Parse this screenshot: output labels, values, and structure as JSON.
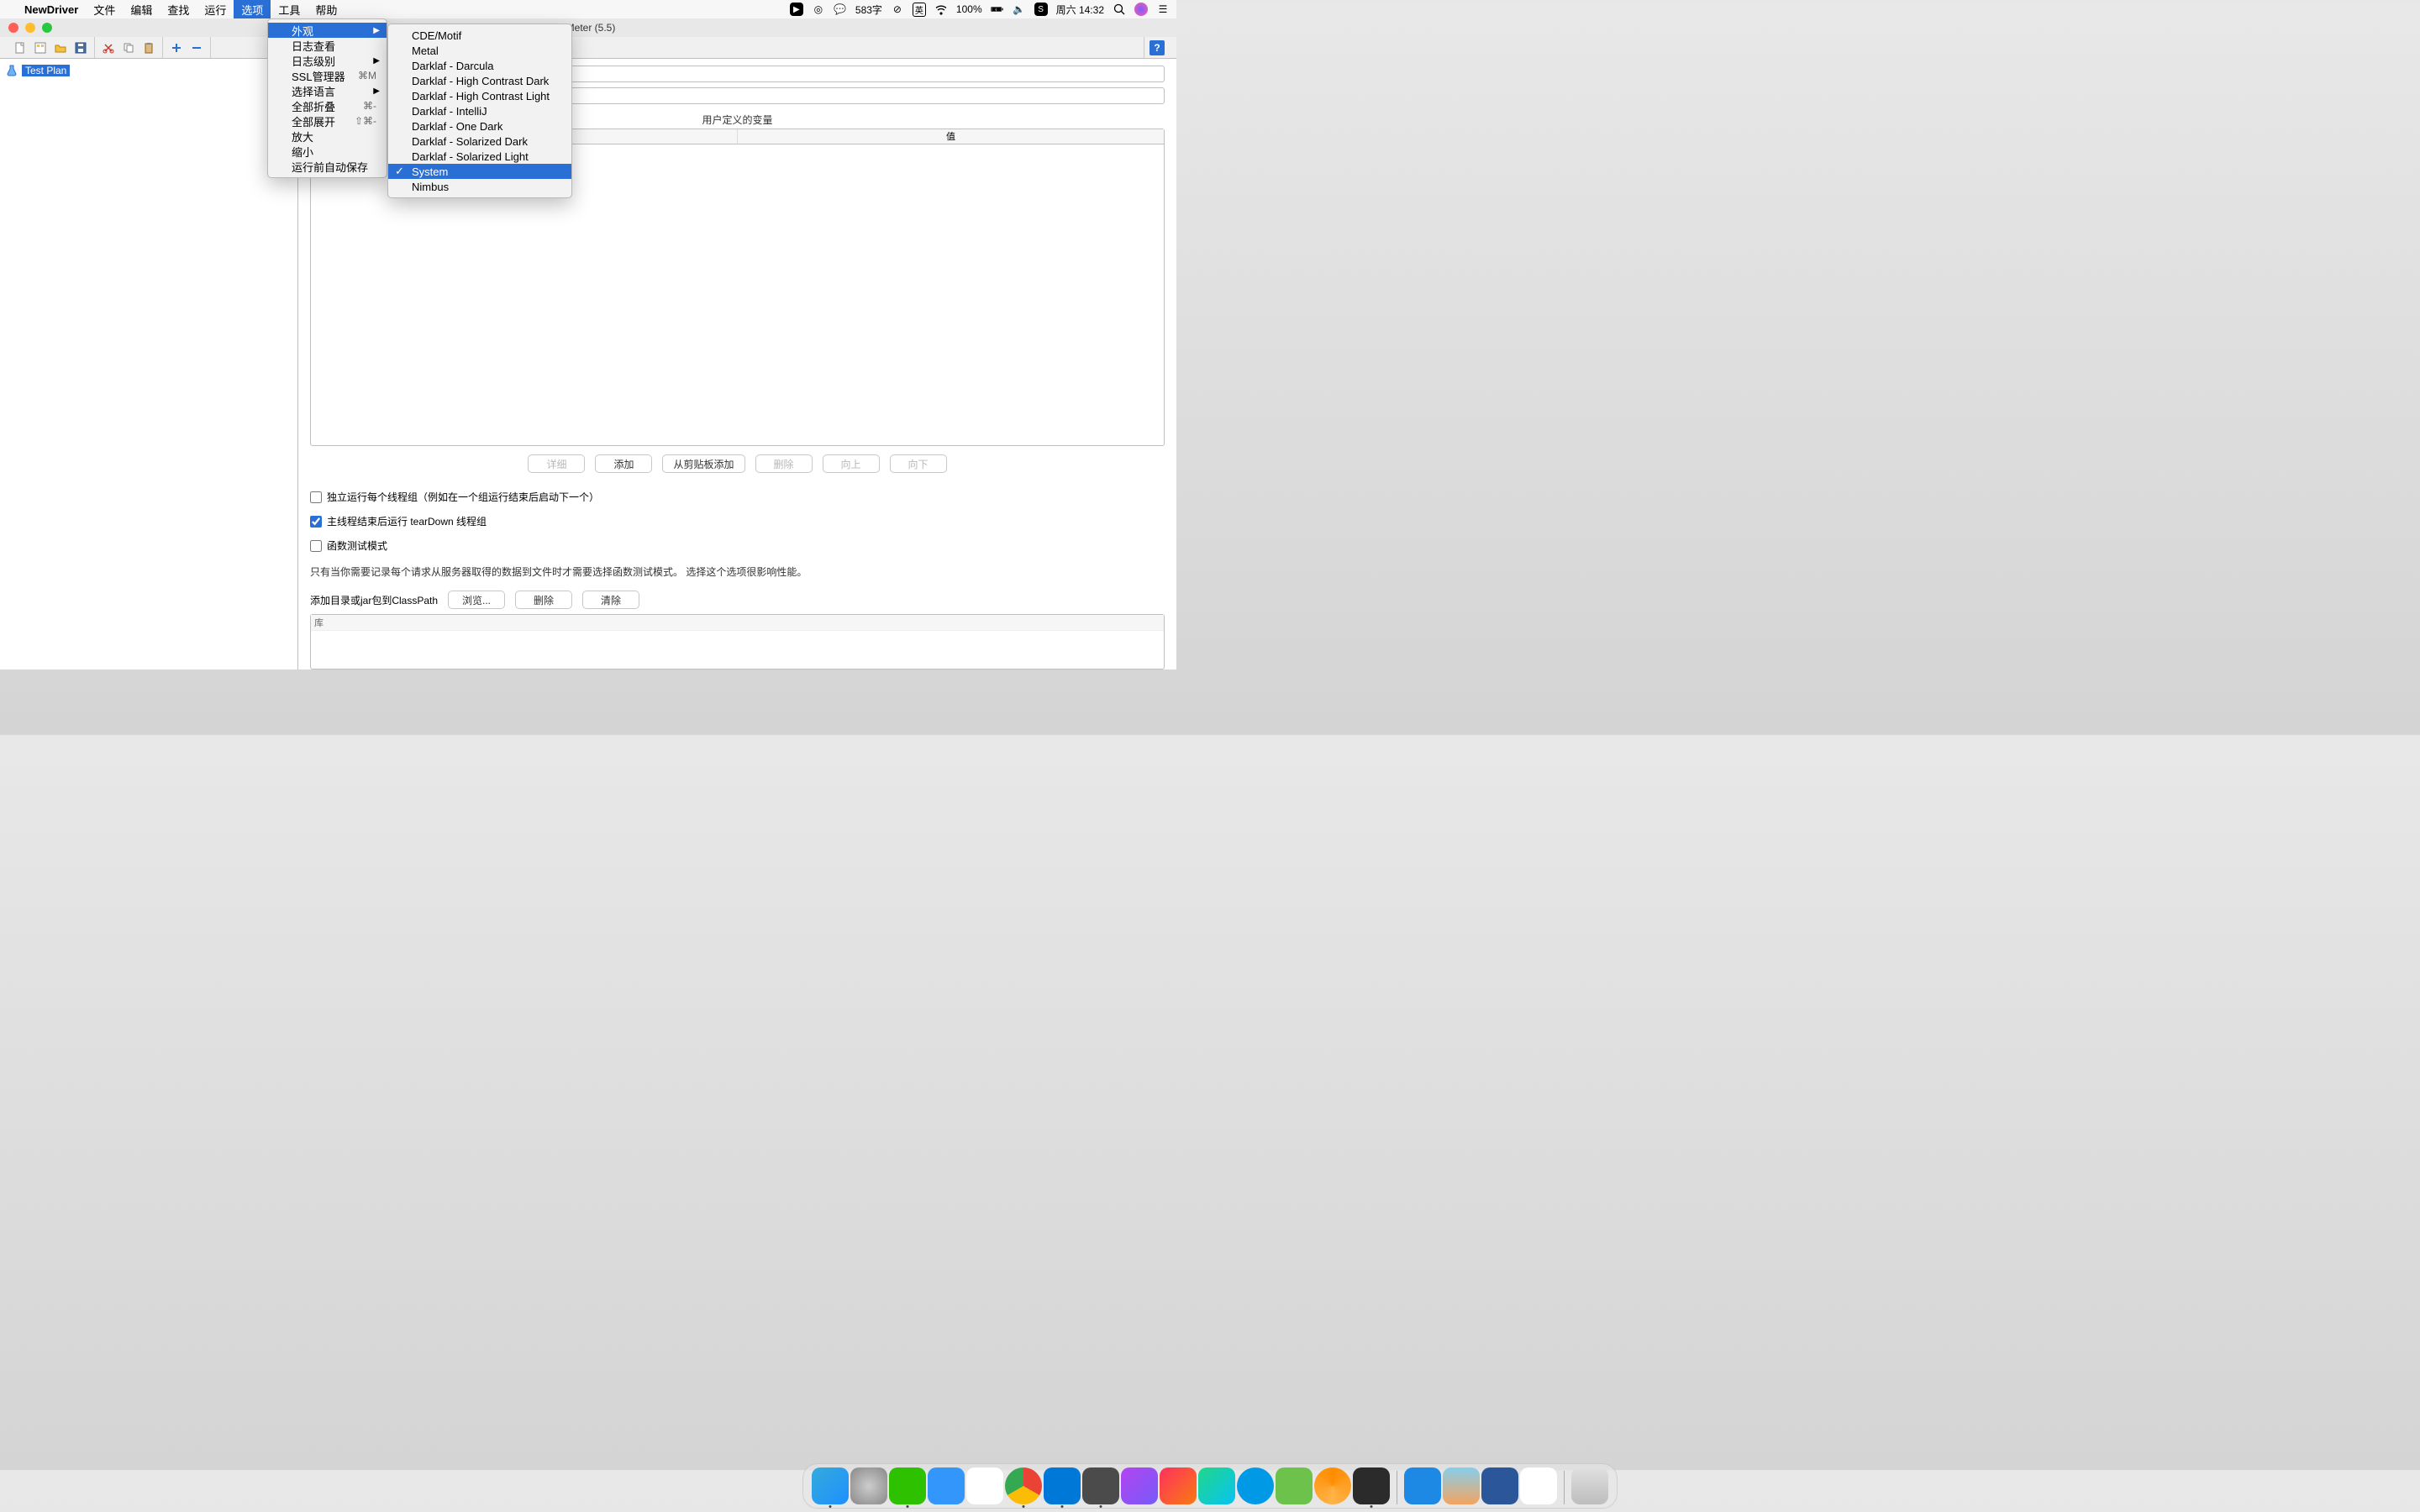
{
  "menubar": {
    "appname": "NewDriver",
    "items": [
      "文件",
      "编辑",
      "查找",
      "运行",
      "选项",
      "工具",
      "帮助"
    ],
    "selected_index": 4,
    "status": {
      "wechat_count": "583字",
      "ime": "英",
      "battery": "100%",
      "date": "周六 14:32"
    }
  },
  "window": {
    "title": "JMeter (5.5)",
    "tree_root": "Test Plan"
  },
  "options_menu": {
    "items": [
      {
        "label": "外观",
        "arrow": true,
        "selected": true
      },
      {
        "label": "日志查看"
      },
      {
        "label": "日志级别",
        "arrow": true
      },
      {
        "label": "SSL管理器",
        "shortcut": "⌘M"
      },
      {
        "label": "选择语言",
        "arrow": true
      },
      {
        "label": "全部折叠",
        "shortcut": "⌘-"
      },
      {
        "label": "全部展开",
        "shortcut": "⇧⌘-"
      },
      {
        "label": "放大"
      },
      {
        "label": "缩小"
      },
      {
        "label": "运行前自动保存"
      }
    ]
  },
  "themes_menu": {
    "items": [
      "CDE/Motif",
      "Metal",
      "Darklaf - Darcula",
      "Darklaf - High Contrast Dark",
      "Darklaf - High Contrast Light",
      "Darklaf - IntelliJ",
      "Darklaf - One Dark",
      "Darklaf - Solarized Dark",
      "Darklaf - Solarized Light",
      "System",
      "Nimbus"
    ],
    "selected_index": 9
  },
  "pane": {
    "vars_title": "用户定义的变量",
    "col_value": "值",
    "buttons": {
      "detail": "详细",
      "add": "添加",
      "addclip": "从剪贴板添加",
      "del": "删除",
      "up": "向上",
      "down": "向下"
    },
    "check1": "独立运行每个线程组（例如在一个组运行结束后启动下一个）",
    "check2": "主线程结束后运行 tearDown 线程组",
    "check3": "函数测试模式",
    "hint": "只有当你需要记录每个请求从服务器取得的数据到文件时才需要选择函数测试模式。 选择这个选项很影响性能。",
    "cp_label": "添加目录或jar包到ClassPath",
    "cp_browse": "浏览...",
    "cp_del": "删除",
    "cp_clear": "清除",
    "lib_header": "库"
  },
  "dock": {
    "apps": [
      "finder",
      "launchpad",
      "wechat",
      "dingtalk",
      "qq",
      "chrome",
      "vscode",
      "sublime",
      "phpstorm",
      "intellij",
      "pycharm",
      "app-blue",
      "app-green",
      "app-orange",
      "terminal",
      "notes",
      "preview",
      "word",
      "java"
    ],
    "active": [
      "finder",
      "wechat",
      "chrome",
      "vscode",
      "sublime",
      "terminal"
    ]
  }
}
